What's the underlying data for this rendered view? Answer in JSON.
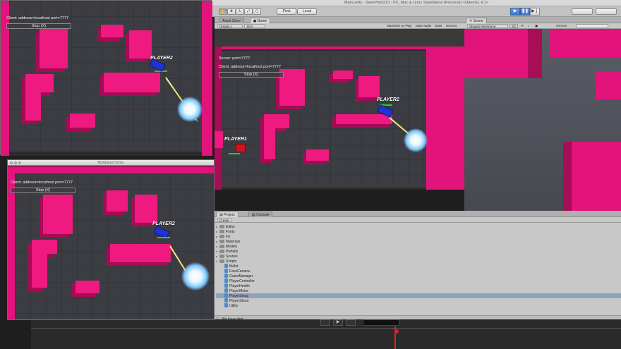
{
  "editor": {
    "title": "Main.unity - SavePoint313 - PC, Mac & Linux Standalone (Personal) <OpenGL 4.1>",
    "pivot_label": "Pivot",
    "local_label": "Local"
  },
  "game_view": {
    "tab_asset_store": "Asset Store",
    "tab_game": "Game",
    "display": "Display 1",
    "aspect": "16:9",
    "maximize_on_play": "Maximize on Play",
    "mute_audio": "Mute audio",
    "stats": "Stats",
    "gizmos": "Gizmos",
    "hud": {
      "server_line": "Server: port=7777",
      "client_line": "Client: address=localhost port=7777",
      "stop_button": "Stop (X)"
    },
    "players": [
      {
        "label": "PLAYER2"
      },
      {
        "label": "PLAYER1"
      }
    ]
  },
  "scene_view": {
    "tab_scene": "Scene",
    "shading": "Shaded Wireframe",
    "mode_2d": "2D",
    "gizmos": "Gizmos"
  },
  "player_window_top": {
    "hud": {
      "client_line": "Client: address=localhost port=7777",
      "stop_button": "Stop (X)"
    },
    "player_label": "PLAYER2"
  },
  "player_window_bottom": {
    "title": "MultiplayerTanks",
    "hud": {
      "client_line": "Client: address=localhost port=7777",
      "stop_button": "Stop (X)"
    },
    "player_label": "PLAYER2"
  },
  "project": {
    "tab_project": "Project",
    "tab_console": "Console",
    "create_label": "Create",
    "folders": [
      "Editor",
      "Fonts",
      "FX",
      "Materials",
      "Models",
      "Prefabs",
      "Scenes",
      "Scripts"
    ],
    "scripts": [
      "Bullet",
      "FaceCamera",
      "GameManager",
      "PlayerController",
      "PlayerHealth",
      "PlayerMotor",
      "PlayerSetup",
      "PlayerShoot",
      "Utility"
    ],
    "selected_script": "PlayerSetup",
    "status": "We have died"
  },
  "colors": {
    "wall_pink": "#e2137a",
    "floor": "#3c3d43",
    "tank_blue": "#2233d4",
    "tank_red": "#d0161c",
    "play_blue": "#3f72c8"
  }
}
